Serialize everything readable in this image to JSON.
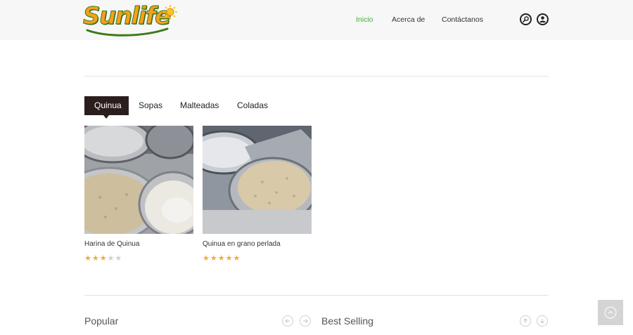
{
  "brand": {
    "logo_text": "Sunlife"
  },
  "nav": {
    "items": [
      {
        "label": "Inicio",
        "active": true
      },
      {
        "label": "Acerca de",
        "active": false
      },
      {
        "label": "Contáctanos",
        "active": false
      }
    ],
    "icons": [
      "search-icon",
      "user-icon"
    ]
  },
  "tabs": [
    {
      "label": "Quinua",
      "active": true
    },
    {
      "label": "Sopas",
      "active": false
    },
    {
      "label": "Malteadas",
      "active": false
    },
    {
      "label": "Coladas",
      "active": false
    }
  ],
  "products": [
    {
      "name": "Harina de Quinua",
      "rating": 3,
      "rating_max": 5
    },
    {
      "name": "Quinua en grano perlada",
      "rating": 5,
      "rating_max": 5
    }
  ],
  "sections": {
    "popular_title": "Popular",
    "best_selling_title": "Best Selling"
  },
  "colors": {
    "accent_nav": "#47a83c",
    "tab_active_bg": "#2a1f1d",
    "star": "#f2a93b",
    "star_empty": "#cfcfcf",
    "logo_orange": "#f6a01a",
    "logo_green": "#3b7a18"
  }
}
